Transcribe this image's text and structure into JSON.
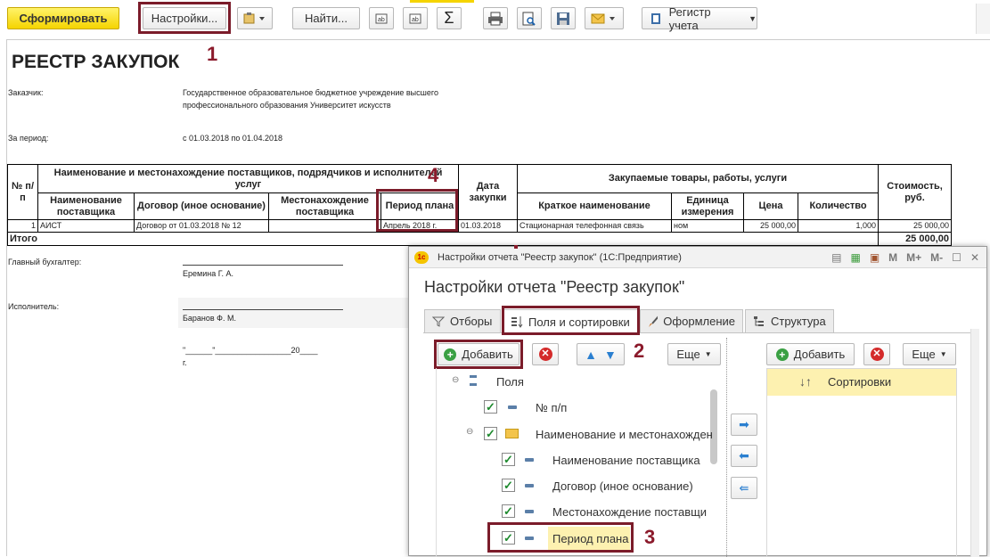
{
  "toolbar": {
    "generate": "Сформировать",
    "settings": "Настройки...",
    "find": "Найти...",
    "sum": "Σ",
    "register": "Регистр учета"
  },
  "annotations": {
    "n1": "1",
    "n2": "2",
    "n3": "3",
    "n4": "4"
  },
  "report": {
    "title": "РЕЕСТР ЗАКУПОК",
    "customer_label": "Заказчик:",
    "customer_line1": "Государственное образовательное бюджетное учреждение высшего",
    "customer_line2": "профессионального образования Университет искусств",
    "period_label": "За период:",
    "period_value": "с 01.03.2018 по 01.04.2018",
    "headers": {
      "num": "№ п/п",
      "group1": "Наименование и местонахождение поставщиков, подрядчиков и исполнителей услуг",
      "supplier": "Наименование поставщика",
      "contract": "Договор (иное основание)",
      "location": "Местонахождение поставщика",
      "plan_period": "Период плана",
      "purchase_date": "Дата закупки",
      "group2": "Закупаемые товары, работы, услуги",
      "short_name": "Краткое наименование",
      "unit": "Единица измерения",
      "price": "Цена",
      "qty": "Количество",
      "cost": "Стоимость, руб."
    },
    "row": {
      "num": "1",
      "supplier": "АИСТ",
      "contract": "Договор от 01.03.2018 № 12",
      "location": "",
      "plan_period": "Апрель 2018 г.",
      "purchase_date": "01.03.2018",
      "short_name": "Стационарная телефонная связь",
      "unit": "ном",
      "price": "25 000,00",
      "qty": "1,000",
      "cost": "25 000,00"
    },
    "total_label": "Итого",
    "total_value": "25 000,00",
    "chief_label": "Главный бухгалтер:",
    "chief_name": "Еремина Г. А.",
    "exec_label": "Исполнитель:",
    "exec_name": "Баранов Ф. М.",
    "date_line": "\"______\"_________________20____",
    "date_suffix": "г."
  },
  "dialog": {
    "window_title": "Настройки отчета \"Реестр закупок\"  (1С:Предприятие)",
    "heading": "Настройки отчета \"Реестр закупок\"",
    "wbtns": {
      "m": "M",
      "mplus": "M+",
      "mminus": "M-"
    },
    "tabs": [
      "Отборы",
      "Поля и сортировки",
      "Оформление",
      "Структура"
    ],
    "add": "Добавить",
    "more": "Еще",
    "add_right": "Добавить",
    "more_right": "Еще",
    "tree": {
      "root": "Поля",
      "items": [
        "№ п/п",
        "Наименование и местонахожден",
        "Наименование поставщика",
        "Договор (иное основание)",
        "Местонахождение поставщи",
        "Период плана"
      ]
    },
    "sort_label": "Сортировки"
  },
  "colors": {
    "accent_red": "#7b1c2a",
    "highlight": "#fdf1b0",
    "green_check": "#1e8a2e"
  }
}
